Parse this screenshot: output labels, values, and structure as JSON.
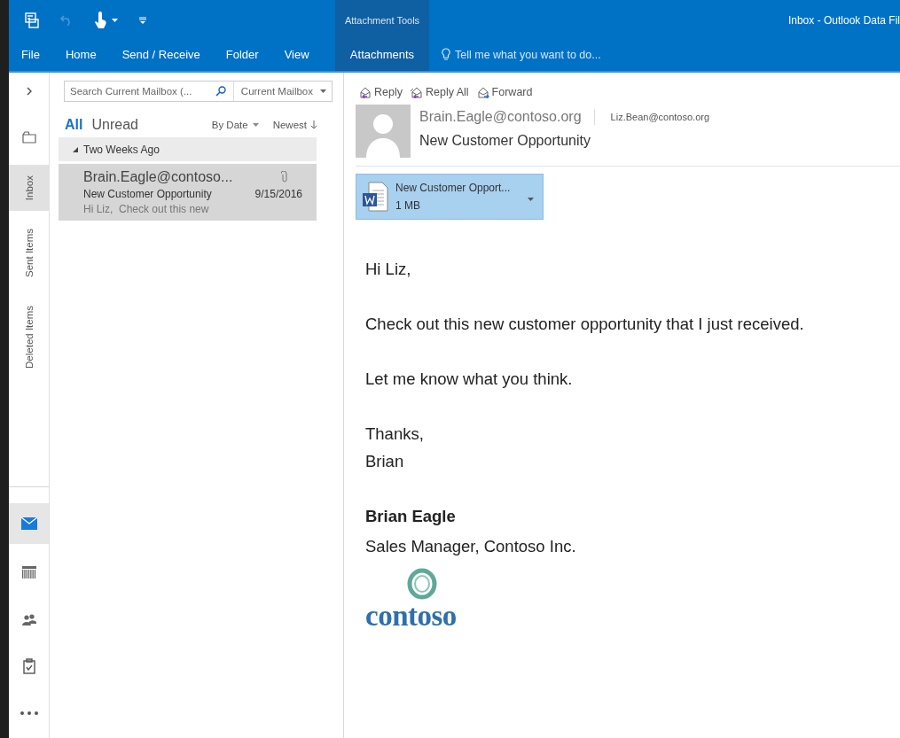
{
  "window": {
    "title": "Inbox - Outlook Data Fil"
  },
  "contextual_group": {
    "label": "Attachment Tools",
    "tab": "Attachments"
  },
  "ribbon_tabs": [
    {
      "label": "File"
    },
    {
      "label": "Home"
    },
    {
      "label": "Send / Receive"
    },
    {
      "label": "Folder"
    },
    {
      "label": "View"
    }
  ],
  "tell_me": {
    "placeholder": "Tell me what you want to do..."
  },
  "folders": [
    {
      "label": "Inbox",
      "selected": true
    },
    {
      "label": "Sent Items",
      "selected": false
    },
    {
      "label": "Deleted Items",
      "selected": false
    }
  ],
  "modules": [
    {
      "kind": "mail",
      "selected": true
    },
    {
      "kind": "calendar",
      "selected": false
    },
    {
      "kind": "people",
      "selected": false
    },
    {
      "kind": "tasks",
      "selected": false
    },
    {
      "kind": "more",
      "selected": false
    }
  ],
  "search": {
    "placeholder": "Search Current Mailbox (...",
    "scope": "Current Mailbox"
  },
  "filters": [
    {
      "label": "All",
      "selected": true
    },
    {
      "label": "Unread",
      "selected": false
    }
  ],
  "sort": {
    "by": "By Date",
    "order": "Newest"
  },
  "groups": [
    {
      "label": "Two Weeks Ago",
      "expanded": true,
      "messages": [
        {
          "sender": "Brain.Eagle@contoso...",
          "subject": "New Customer Opportunity",
          "date": "9/15/2016",
          "preview": "Hi Liz,  Check out this new",
          "has_attachment": true,
          "selected": true
        }
      ]
    }
  ],
  "actions": [
    {
      "kind": "reply",
      "label": "Reply"
    },
    {
      "kind": "reply_all",
      "label": "Reply All"
    },
    {
      "kind": "forward",
      "label": "Forward"
    }
  ],
  "message": {
    "from": "Brain.Eagle@contoso.org",
    "to": "Liz.Bean@contoso.org",
    "subject": "New Customer Opportunity",
    "attachment": {
      "name": "New Customer Opport...",
      "size": "1 MB",
      "selected": true
    },
    "paragraphs": [
      [
        "Hi Liz,"
      ],
      [
        "Check out this new customer opportunity that I just received."
      ],
      [
        "Let me know what you think."
      ],
      [
        "Thanks,",
        "Brian"
      ]
    ],
    "signature": {
      "name": "Brian Eagle",
      "title": "Sales Manager, Contoso Inc.",
      "logo": "contoso"
    }
  }
}
